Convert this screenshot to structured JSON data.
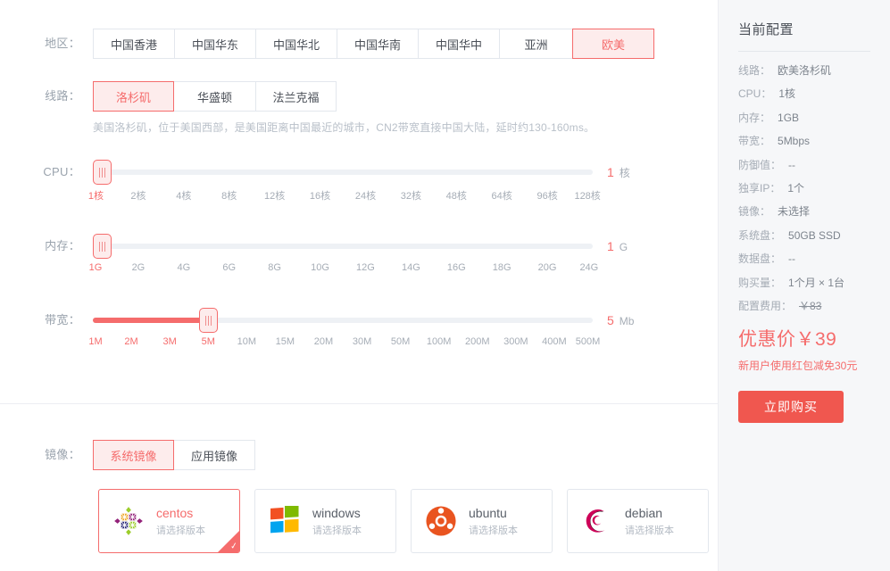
{
  "region": {
    "label": "地区：",
    "options": [
      "中国香港",
      "中国华东",
      "中国华北",
      "中国华南",
      "中国华中",
      "亚洲",
      "欧美"
    ],
    "selected": "欧美"
  },
  "line": {
    "label": "线路：",
    "options": [
      "洛杉矶",
      "华盛顿",
      "法兰克福"
    ],
    "selected": "洛杉矶",
    "description": "美国洛杉矶，位于美国西部，是美国距离中国最近的城市，CN2带宽直接中国大陆，延时约130-160ms。"
  },
  "cpu": {
    "label": "CPU：",
    "ticks": [
      "1核",
      "2核",
      "4核",
      "8核",
      "12核",
      "16核",
      "24核",
      "32核",
      "48核",
      "64核",
      "96核",
      "128核"
    ],
    "selected_index": 0,
    "value": "1",
    "unit": "核"
  },
  "memory": {
    "label": "内存：",
    "ticks": [
      "1G",
      "2G",
      "4G",
      "6G",
      "8G",
      "10G",
      "12G",
      "14G",
      "16G",
      "18G",
      "20G",
      "24G"
    ],
    "selected_index": 0,
    "value": "1",
    "unit": "G"
  },
  "bandwidth": {
    "label": "带宽：",
    "ticks": [
      "1M",
      "2M",
      "3M",
      "5M",
      "10M",
      "15M",
      "20M",
      "30M",
      "50M",
      "100M",
      "200M",
      "300M",
      "400M",
      "500M"
    ],
    "selected_index": 3,
    "value": "5",
    "unit": "Mb"
  },
  "image": {
    "label": "镜像：",
    "tabs": [
      "系统镜像",
      "应用镜像"
    ],
    "selected_tab": "系统镜像",
    "cards": [
      {
        "name": "centos",
        "sub": "请选择版本",
        "logo": "centos-logo",
        "selected": true
      },
      {
        "name": "windows",
        "sub": "请选择版本",
        "logo": "windows-logo",
        "selected": false
      },
      {
        "name": "ubuntu",
        "sub": "请选择版本",
        "logo": "ubuntu-logo",
        "selected": false
      },
      {
        "name": "debian",
        "sub": "请选择版本",
        "logo": "debian-logo",
        "selected": false
      }
    ]
  },
  "summary": {
    "title": "当前配置",
    "items": [
      {
        "key": "线路：",
        "value": "欧美洛杉矶"
      },
      {
        "key": "CPU：",
        "value": "1核"
      },
      {
        "key": "内存：",
        "value": "1GB"
      },
      {
        "key": "带宽：",
        "value": "5Mbps"
      },
      {
        "key": "防御值：",
        "value": "--"
      },
      {
        "key": "独享IP：",
        "value": "1个"
      },
      {
        "key": "镜像：",
        "value": "未选择"
      },
      {
        "key": "系统盘：",
        "value": "50GB SSD"
      },
      {
        "key": "数据盘：",
        "value": "--"
      },
      {
        "key": "购买量：",
        "value": "1个月 × 1台"
      },
      {
        "key": "配置费用：",
        "value": "￥83",
        "strike": true
      }
    ],
    "price": "优惠价￥39",
    "promo": "新用户使用红包减免30元",
    "buy_button": "立即购买"
  },
  "colors": {
    "accent": "#f56c6c",
    "accent_bg": "#fdecec",
    "buy_button": "#f0574f",
    "track": "#eef1f5",
    "border": "#e3e7ed",
    "sidebar_bg": "#f6f7f9"
  }
}
